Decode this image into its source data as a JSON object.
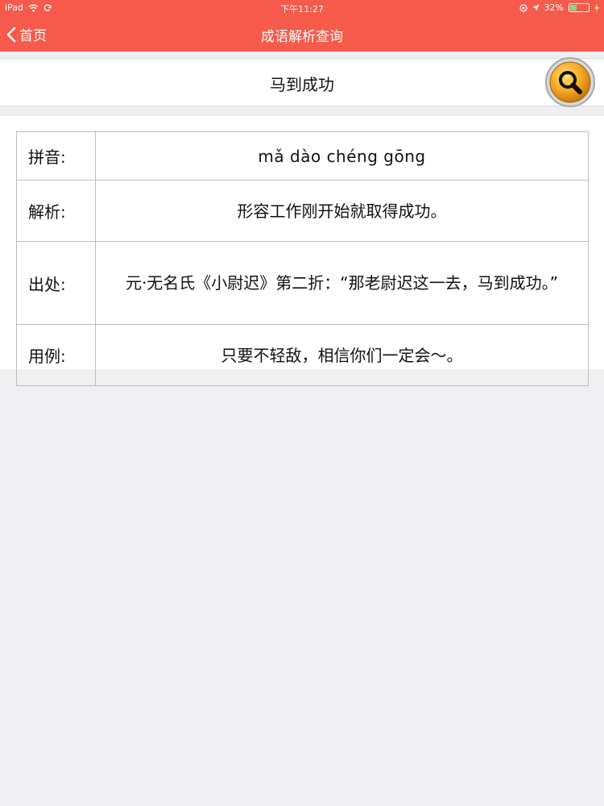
{
  "status_bar": {
    "device": "iPad",
    "time": "下午11:27",
    "battery": "32%",
    "battery_level": 0.32
  },
  "nav": {
    "back_label": "首页",
    "title": "成语解析查询"
  },
  "search": {
    "query": "马到成功"
  },
  "result": {
    "pinyin_label": "拼音:",
    "pinyin": "mǎ dào chéng gōng",
    "meaning_label": "解析:",
    "meaning": "形容工作刚开始就取得成功。",
    "source_label": "出处:",
    "source": "元·无名氏《小尉迟》第二折：“那老尉迟这一去，马到成功。”",
    "example_label": "用例:",
    "example": "只要不轻敌，相信你们一定会～。"
  },
  "colors": {
    "accent": "#f65a4b",
    "background": "#efeff1",
    "search_button": "#f5a623"
  }
}
